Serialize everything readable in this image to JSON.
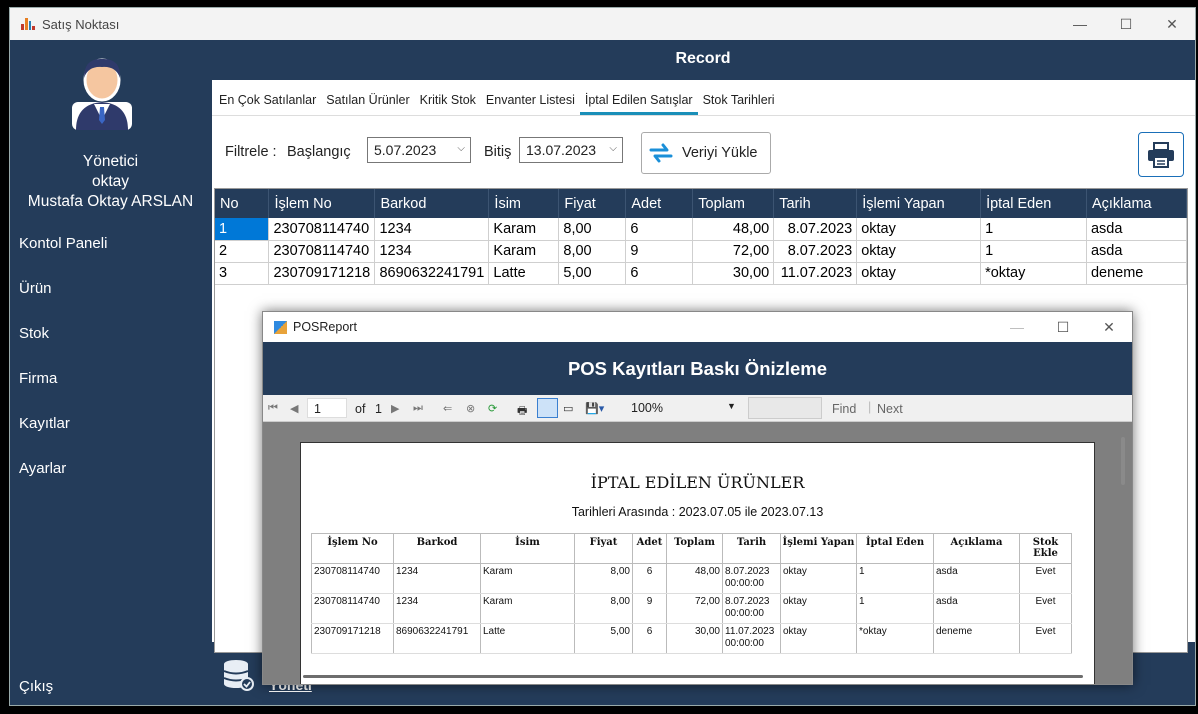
{
  "window": {
    "title": "Satış Noktası",
    "minimize": "—",
    "maximize": "☐",
    "close": "✕"
  },
  "sidebar": {
    "role": "Yönetici",
    "username": "oktay",
    "fullname": "Mustafa Oktay ARSLAN",
    "items": [
      {
        "label": "Kontol Paneli"
      },
      {
        "label": "Ürün"
      },
      {
        "label": "Stok"
      },
      {
        "label": "Firma"
      },
      {
        "label": "Kayıtlar"
      },
      {
        "label": "Ayarlar"
      }
    ],
    "logout": "Çıkış"
  },
  "main": {
    "title": "Record",
    "tabs": [
      {
        "label": "En Çok Satılanlar"
      },
      {
        "label": "Satılan Ürünler"
      },
      {
        "label": "Kritik Stok"
      },
      {
        "label": "Envanter Listesi"
      },
      {
        "label": "İptal Edilen Satışlar",
        "active": true
      },
      {
        "label": "Stok Tarihleri"
      }
    ],
    "filter": {
      "label": "Filtrele :",
      "start_label": "Başlangıç",
      "start_value": "5.07.2023",
      "end_label": "Bitiş",
      "end_value": "13.07.2023",
      "load_button": "Veriyi Yükle"
    },
    "grid": {
      "columns": [
        "No",
        "İşlem No",
        "Barkod",
        "İsim",
        "Fiyat",
        "Adet",
        "Toplam",
        "Tarih",
        "İşlemi Yapan",
        "İptal Eden",
        "Açıklama"
      ],
      "rows": [
        [
          "1",
          "230708114740",
          "1234",
          "Karam",
          "8,00",
          "6",
          "48,00",
          "8.07.2023",
          "oktay",
          "1",
          "asda"
        ],
        [
          "2",
          "230708114740",
          "1234",
          "Karam",
          "8,00",
          "9",
          "72,00",
          "8.07.2023",
          "oktay",
          "1",
          "asda"
        ],
        [
          "3",
          "230709171218",
          "8690632241791",
          "Latte",
          "5,00",
          "6",
          "30,00",
          "11.07.2023",
          "oktay",
          "*oktay",
          "deneme"
        ]
      ]
    },
    "bottom_link": "Yöneti"
  },
  "report": {
    "title": "POSReport",
    "header": "POS Kayıtları Baskı Önizleme",
    "toolbar": {
      "page": "1",
      "of_label": "of",
      "total_pages": "1",
      "zoom": "100%",
      "find": "Find",
      "next": "Next"
    },
    "document": {
      "title": "İPTAL EDİLEN ÜRÜNLER",
      "subtitle": "Tarihleri Arasında : 2023.07.05 ile 2023.07.13",
      "columns": [
        "İşlem No",
        "Barkod",
        "İsim",
        "Fiyat",
        "Adet",
        "Toplam",
        "Tarih",
        "İşlemi Yapan",
        "İptal Eden",
        "Açıklama",
        "Stok Ekle"
      ],
      "rows": [
        [
          "230708114740",
          "1234",
          "Karam",
          "8,00",
          "6",
          "48,00",
          "8.07.2023 00:00:00",
          "oktay",
          "1",
          "asda",
          "Evet"
        ],
        [
          "230708114740",
          "1234",
          "Karam",
          "8,00",
          "9",
          "72,00",
          "8.07.2023 00:00:00",
          "oktay",
          "1",
          "asda",
          "Evet"
        ],
        [
          "230709171218",
          "8690632241791",
          "Latte",
          "5,00",
          "6",
          "30,00",
          "11.07.2023 00:00:00",
          "oktay",
          "*oktay",
          "deneme",
          "Evet"
        ]
      ]
    }
  }
}
